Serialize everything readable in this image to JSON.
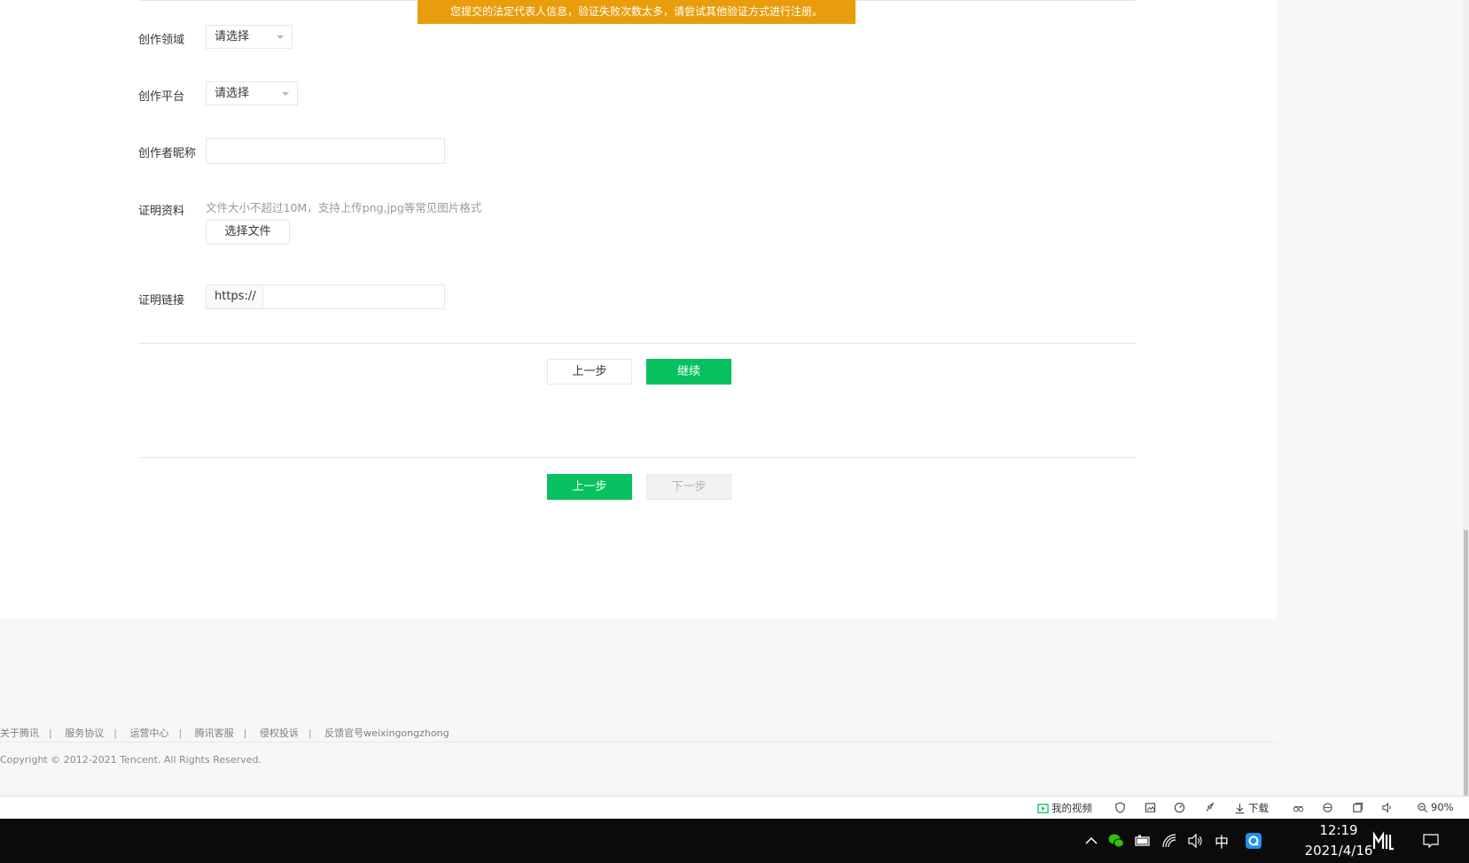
{
  "toast": {
    "message": "您提交的法定代表人信息，验证失败次数太多，请尝试其他验证方式进行注册。"
  },
  "form": {
    "field_domain": {
      "label": "创作领域",
      "value": "请选择"
    },
    "field_platform": {
      "label": "创作平台",
      "value": "请选择"
    },
    "field_nickname": {
      "label": "创作者昵称",
      "value": ""
    },
    "field_proof": {
      "label": "证明资料",
      "hint": "文件大小不超过10M，支持上传png,jpg等常见图片格式",
      "choose_file": "选择文件"
    },
    "field_link": {
      "label": "证明链接",
      "prefix": "https://",
      "value": ""
    },
    "inner_prev": "上一步",
    "inner_continue": "继续"
  },
  "actions": {
    "prev": "上一步",
    "next": "下一步"
  },
  "footer": {
    "links": [
      "关于腾讯",
      "服务协议",
      "运营中心",
      "腾讯客服",
      "侵权投诉",
      "反馈官号weixingongzhong"
    ],
    "copyright": "Copyright © 2012-2021 Tencent. All Rights Reserved."
  },
  "browser_status": {
    "my_video": "我的视频",
    "download": "下载",
    "zoom": "90%"
  },
  "taskbar": {
    "ime": "中",
    "time": "12:19",
    "date": "2021/4/16"
  },
  "colors": {
    "primary": "#07c160",
    "warning": "#e99d0c"
  }
}
